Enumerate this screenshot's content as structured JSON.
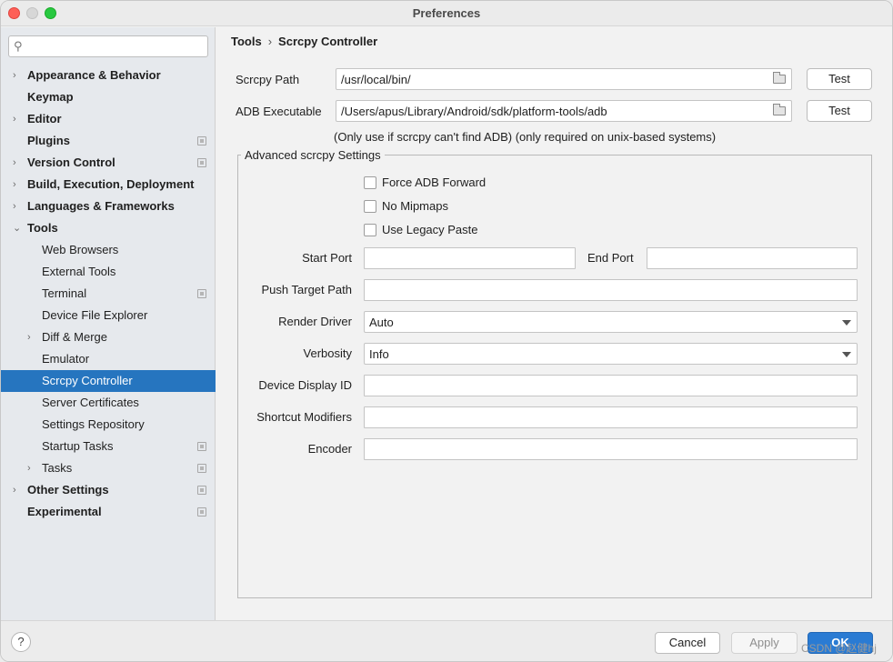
{
  "window": {
    "title": "Preferences"
  },
  "search": {
    "placeholder": ""
  },
  "tree": [
    {
      "label": "Appearance & Behavior",
      "level": 0,
      "bold": true,
      "arrow": "›",
      "badge": false,
      "selected": false
    },
    {
      "label": "Keymap",
      "level": 0,
      "bold": true,
      "arrow": "",
      "badge": false,
      "selected": false
    },
    {
      "label": "Editor",
      "level": 0,
      "bold": true,
      "arrow": "›",
      "badge": false,
      "selected": false
    },
    {
      "label": "Plugins",
      "level": 0,
      "bold": true,
      "arrow": "",
      "badge": true,
      "selected": false
    },
    {
      "label": "Version Control",
      "level": 0,
      "bold": true,
      "arrow": "›",
      "badge": true,
      "selected": false
    },
    {
      "label": "Build, Execution, Deployment",
      "level": 0,
      "bold": true,
      "arrow": "›",
      "badge": false,
      "selected": false
    },
    {
      "label": "Languages & Frameworks",
      "level": 0,
      "bold": true,
      "arrow": "›",
      "badge": false,
      "selected": false
    },
    {
      "label": "Tools",
      "level": 0,
      "bold": true,
      "arrow": "⌄",
      "badge": false,
      "selected": false
    },
    {
      "label": "Web Browsers",
      "level": 1,
      "bold": false,
      "arrow": "",
      "badge": false,
      "selected": false
    },
    {
      "label": "External Tools",
      "level": 1,
      "bold": false,
      "arrow": "",
      "badge": false,
      "selected": false
    },
    {
      "label": "Terminal",
      "level": 1,
      "bold": false,
      "arrow": "",
      "badge": true,
      "selected": false
    },
    {
      "label": "Device File Explorer",
      "level": 1,
      "bold": false,
      "arrow": "",
      "badge": false,
      "selected": false
    },
    {
      "label": "Diff & Merge",
      "level": 1,
      "bold": false,
      "arrow": "›",
      "badge": false,
      "selected": false
    },
    {
      "label": "Emulator",
      "level": 1,
      "bold": false,
      "arrow": "",
      "badge": false,
      "selected": false
    },
    {
      "label": "Scrcpy Controller",
      "level": 1,
      "bold": false,
      "arrow": "",
      "badge": false,
      "selected": true
    },
    {
      "label": "Server Certificates",
      "level": 1,
      "bold": false,
      "arrow": "",
      "badge": false,
      "selected": false
    },
    {
      "label": "Settings Repository",
      "level": 1,
      "bold": false,
      "arrow": "",
      "badge": false,
      "selected": false
    },
    {
      "label": "Startup Tasks",
      "level": 1,
      "bold": false,
      "arrow": "",
      "badge": true,
      "selected": false
    },
    {
      "label": "Tasks",
      "level": 1,
      "bold": false,
      "arrow": "›",
      "badge": true,
      "selected": false
    },
    {
      "label": "Other Settings",
      "level": 0,
      "bold": true,
      "arrow": "›",
      "badge": true,
      "selected": false
    },
    {
      "label": "Experimental",
      "level": 0,
      "bold": true,
      "arrow": "",
      "badge": true,
      "selected": false
    }
  ],
  "breadcrumb": {
    "parent": "Tools",
    "separator": "›",
    "current": "Scrcpy Controller"
  },
  "scrcpy_path": {
    "label": "Scrcpy Path",
    "value": "/usr/local/bin/",
    "test_label": "Test"
  },
  "adb_exec": {
    "label": "ADB Executable",
    "value": "/Users/apus/Library/Android/sdk/platform-tools/adb",
    "test_label": "Test"
  },
  "adb_note": "(Only use if scrcpy can't find ADB) (only required on unix-based systems)",
  "advanced": {
    "title": "Advanced scrcpy Settings",
    "force_adb_forward": "Force ADB Forward",
    "no_mipmaps": "No Mipmaps",
    "use_legacy_paste": "Use Legacy Paste",
    "start_port_label": "Start Port",
    "start_port_value": "",
    "end_port_label": "End Port",
    "end_port_value": "",
    "push_target_label": "Push Target Path",
    "push_target_value": "",
    "render_driver_label": "Render Driver",
    "render_driver_value": "Auto",
    "verbosity_label": "Verbosity",
    "verbosity_value": "Info",
    "display_id_label": "Device Display ID",
    "display_id_value": "",
    "shortcut_label": "Shortcut Modifiers",
    "shortcut_value": "",
    "encoder_label": "Encoder",
    "encoder_value": ""
  },
  "footer": {
    "help": "?",
    "cancel": "Cancel",
    "apply": "Apply",
    "ok": "OK"
  },
  "watermark": "CSDN @赵健hj",
  "colors": {
    "selection": "#2675bf",
    "ok_button": "#2a7bd3"
  }
}
